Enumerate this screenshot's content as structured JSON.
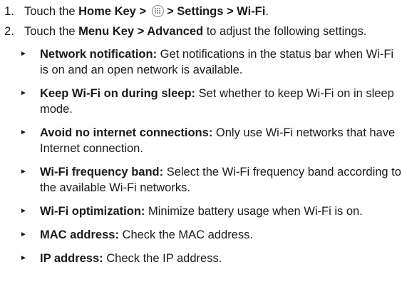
{
  "steps": [
    {
      "number": "1.",
      "prefix": "Touch the ",
      "bold1": "Home Key >",
      "icon": "apps-icon",
      "bold2": "> Settings > Wi-Fi",
      "suffix": "."
    },
    {
      "number": "2.",
      "prefix": "Touch the ",
      "bold": "Menu Key > Advanced",
      "suffix": " to adjust the following settings."
    }
  ],
  "bullet_marker": "►",
  "settings": [
    {
      "label": "Network notification:",
      "description": " Get notifications in the status bar when Wi-Fi is on and an open network is available."
    },
    {
      "label": "Keep Wi-Fi on during sleep:",
      "description": " Set whether to keep Wi-Fi on in sleep mode."
    },
    {
      "label": "Avoid no internet connections:",
      "description": " Only use Wi-Fi networks that have Internet connection."
    },
    {
      "label": "Wi-Fi frequency band:",
      "description": " Select the Wi-Fi frequency band according to the available Wi-Fi networks."
    },
    {
      "label": "Wi-Fi optimization:",
      "description": " Minimize battery usage when Wi-Fi is on."
    },
    {
      "label": "MAC address:",
      "description": " Check the MAC address."
    },
    {
      "label": "IP address:",
      "description": " Check the IP address."
    }
  ]
}
